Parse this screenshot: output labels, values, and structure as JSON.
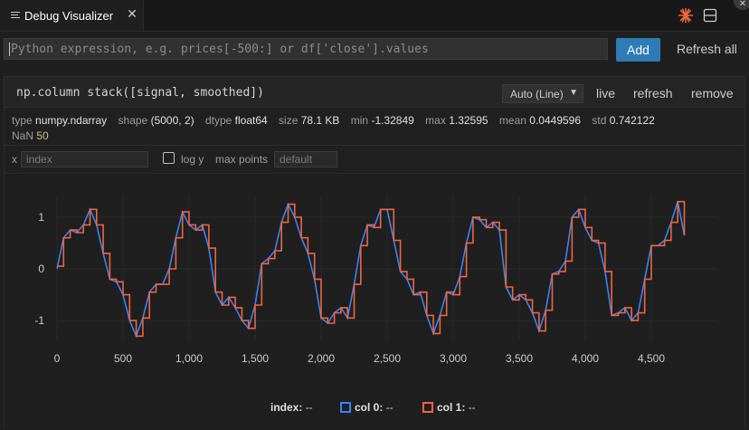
{
  "tab": {
    "title": "Debug Visualizer",
    "icon": "menu-lines-icon",
    "close_glyph": "✕"
  },
  "toolbar_icons": [
    "burst-icon",
    "split-layout-icon"
  ],
  "overflow_glyph": "✕",
  "expression": {
    "value": "",
    "placeholder": "Python expression, e.g. prices[-500:] or df['close'].values"
  },
  "add_label": "Add",
  "refresh_all_label": "Refresh all",
  "card": {
    "title": "np.column stack([signal, smoothed])",
    "mode": "Auto (Line)",
    "actions": {
      "live": "live",
      "refresh": "refresh",
      "remove": "remove"
    },
    "meta": {
      "type_key": "type",
      "type": "numpy.ndarray",
      "shape_key": "shape",
      "shape": "(5000, 2)",
      "dtype_key": "dtype",
      "dtype": "float64",
      "size_key": "size",
      "size": "78.1 KB",
      "min_key": "min",
      "min": "-1.32849",
      "max_key": "max",
      "max": "1.32595",
      "mean_key": "mean",
      "mean": "0.0449596",
      "std_key": "std",
      "std": "0.742122",
      "nan_key": "NaN",
      "nan": "50"
    },
    "options": {
      "x_label": "x",
      "x_placeholder": "index",
      "logy_label": "log y",
      "maxpoints_label": "max points",
      "maxpoints_placeholder": "default"
    }
  },
  "legend": {
    "index_label": "index:",
    "index_value": "--",
    "col0_label": "col 0:",
    "col0_value": "--",
    "col1_label": "col 1:",
    "col1_value": "--"
  },
  "colors": {
    "accent": "#2e7bb6",
    "col0": "#3b82f6",
    "col1": "#f0643c",
    "grid": "#2a2a2a",
    "nan_value": "#d7ba7d"
  },
  "chart_data": {
    "type": "line",
    "xlim": [
      0,
      5000
    ],
    "ylim": [
      -1.4,
      1.4
    ],
    "x_ticks": [
      0,
      500,
      1000,
      1500,
      2000,
      2500,
      3000,
      3500,
      4000,
      4500
    ],
    "x_tick_labels": [
      "0",
      "500",
      "1,000",
      "1,500",
      "2,000",
      "2,500",
      "3,000",
      "3,500",
      "4,000",
      "4,500"
    ],
    "y_ticks": [
      1,
      0,
      -1
    ],
    "y_tick_labels": [
      "1",
      "0",
      "-1"
    ],
    "x": [
      0,
      50,
      100,
      150,
      200,
      250,
      300,
      350,
      400,
      450,
      500,
      550,
      600,
      650,
      700,
      750,
      800,
      850,
      900,
      950,
      1000,
      1050,
      1100,
      1150,
      1200,
      1250,
      1300,
      1350,
      1400,
      1450,
      1500,
      1550,
      1600,
      1650,
      1700,
      1750,
      1800,
      1850,
      1900,
      1950,
      2000,
      2050,
      2100,
      2150,
      2200,
      2250,
      2300,
      2350,
      2400,
      2450,
      2500,
      2550,
      2600,
      2650,
      2700,
      2750,
      2800,
      2850,
      2900,
      2950,
      3000,
      3050,
      3100,
      3150,
      3200,
      3250,
      3300,
      3350,
      3400,
      3450,
      3500,
      3550,
      3600,
      3650,
      3700,
      3750,
      3800,
      3850,
      3900,
      3950,
      4000,
      4050,
      4100,
      4150,
      4200,
      4250,
      4300,
      4350,
      4400,
      4450,
      4500,
      4550,
      4600,
      4650,
      4700,
      4750,
      4800,
      4850,
      4900,
      4950,
      5000
    ],
    "series": [
      {
        "name": "col 0",
        "values": [
          0.0,
          0.6,
          0.75,
          0.7,
          0.85,
          1.15,
          0.85,
          0.3,
          -0.2,
          -0.25,
          -0.5,
          -1.0,
          -1.3,
          -0.95,
          -0.45,
          -0.3,
          -0.3,
          0.0,
          0.6,
          1.1,
          0.85,
          0.75,
          0.85,
          0.4,
          -0.45,
          -0.7,
          -0.55,
          -0.75,
          -1.0,
          -1.15,
          -0.7,
          0.1,
          0.2,
          0.35,
          0.9,
          1.25,
          1.0,
          0.6,
          0.3,
          -0.2,
          -0.95,
          -1.05,
          -0.85,
          -0.75,
          -0.95,
          -0.3,
          0.45,
          0.85,
          0.8,
          1.15,
          1.15,
          0.55,
          -0.05,
          -0.2,
          -0.5,
          -0.45,
          -0.9,
          -1.25,
          -0.9,
          -0.45,
          -0.5,
          -0.15,
          0.5,
          1.0,
          0.95,
          0.8,
          0.9,
          0.75,
          -0.35,
          -0.6,
          -0.5,
          -0.6,
          -0.85,
          -1.2,
          -0.8,
          -0.1,
          -0.05,
          0.15,
          1.0,
          1.15,
          0.8,
          0.55,
          0.5,
          -0.05,
          -0.9,
          -0.85,
          -0.75,
          -1.0,
          -0.85,
          -0.2,
          0.45,
          0.45,
          0.55,
          0.9,
          1.3,
          0.65
        ]
      },
      {
        "name": "col 1",
        "values": [
          0.05,
          0.6,
          0.75,
          0.7,
          0.85,
          1.15,
          0.85,
          0.3,
          -0.2,
          -0.25,
          -0.5,
          -1.0,
          -1.3,
          -0.95,
          -0.45,
          -0.3,
          -0.3,
          0.0,
          0.6,
          1.1,
          0.85,
          0.75,
          0.85,
          0.4,
          -0.45,
          -0.7,
          -0.55,
          -0.75,
          -1.0,
          -1.15,
          -0.7,
          0.1,
          0.2,
          0.35,
          0.9,
          1.25,
          1.0,
          0.6,
          0.3,
          -0.2,
          -0.95,
          -1.05,
          -0.85,
          -0.75,
          -0.95,
          -0.3,
          0.45,
          0.85,
          0.8,
          1.15,
          1.15,
          0.55,
          -0.05,
          -0.2,
          -0.5,
          -0.45,
          -0.9,
          -1.25,
          -0.9,
          -0.45,
          -0.5,
          -0.15,
          0.5,
          1.0,
          0.95,
          0.8,
          0.9,
          0.75,
          -0.35,
          -0.6,
          -0.5,
          -0.6,
          -0.85,
          -1.2,
          -0.8,
          -0.1,
          -0.05,
          0.15,
          1.0,
          1.15,
          0.8,
          0.55,
          0.5,
          -0.05,
          -0.9,
          -0.85,
          -0.75,
          -1.0,
          -0.85,
          -0.2,
          0.45,
          0.45,
          0.55,
          0.9,
          1.3,
          0.65
        ]
      }
    ]
  }
}
